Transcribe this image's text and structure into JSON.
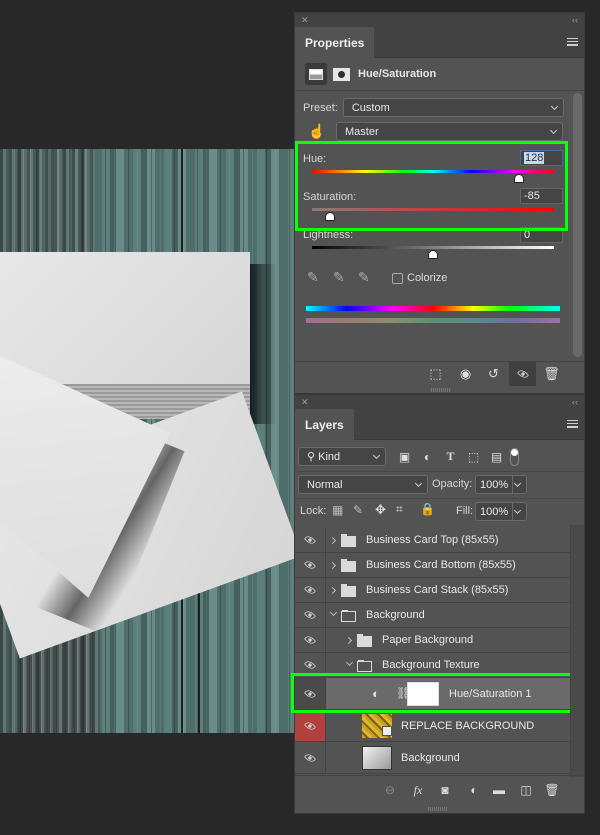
{
  "canvas": {
    "description": "Business card mockup on teal wooden planks"
  },
  "properties": {
    "tab_label": "Properties",
    "adjustment_title": "Hue/Saturation",
    "preset_label": "Preset:",
    "preset_value": "Custom",
    "channel_value": "Master",
    "hue_label": "Hue:",
    "hue_value": "128",
    "hue_fraction": 0.856,
    "saturation_label": "Saturation:",
    "saturation_value": "-85",
    "saturation_fraction": 0.075,
    "lightness_label": "Lightness:",
    "lightness_value": "0",
    "lightness_fraction": 0.5,
    "colorize_label": "Colorize",
    "colorize_checked": false,
    "footer_buttons": [
      "clip-to-layer",
      "view-previous-state",
      "reset",
      "toggle-visibility",
      "delete"
    ]
  },
  "layers": {
    "tab_label": "Layers",
    "filter_kind": "Kind",
    "blend_mode": "Normal",
    "opacity_label": "Opacity:",
    "opacity_value": "100%",
    "lock_label": "Lock:",
    "fill_label": "Fill:",
    "fill_value": "100%",
    "items": [
      {
        "name": "Business Card Top (85x55)",
        "type": "group",
        "expanded": false,
        "depth": 0,
        "visible": true
      },
      {
        "name": "Business Card Bottom (85x55)",
        "type": "group",
        "expanded": false,
        "depth": 0,
        "visible": true
      },
      {
        "name": "Business Card Stack (85x55)",
        "type": "group",
        "expanded": false,
        "depth": 0,
        "visible": true
      },
      {
        "name": "Background",
        "type": "group",
        "expanded": true,
        "depth": 0,
        "visible": true
      },
      {
        "name": "Paper Background",
        "type": "group",
        "expanded": false,
        "depth": 1,
        "visible": true
      },
      {
        "name": "Background Texture",
        "type": "group",
        "expanded": true,
        "depth": 1,
        "visible": true
      },
      {
        "name": "Hue/Saturation 1",
        "type": "adjustment",
        "depth": 2,
        "visible": true,
        "selected": true
      },
      {
        "name": "REPLACE BACKGROUND",
        "type": "smart-object",
        "depth": 2,
        "visible": true,
        "eye_highlight": "#b1403f"
      },
      {
        "name": "Background",
        "type": "pixel",
        "depth": 2,
        "visible": true
      }
    ]
  },
  "colors": {
    "highlight_box": "#0cff0c",
    "panel_bg": "#535353",
    "app_bg": "#282828"
  }
}
